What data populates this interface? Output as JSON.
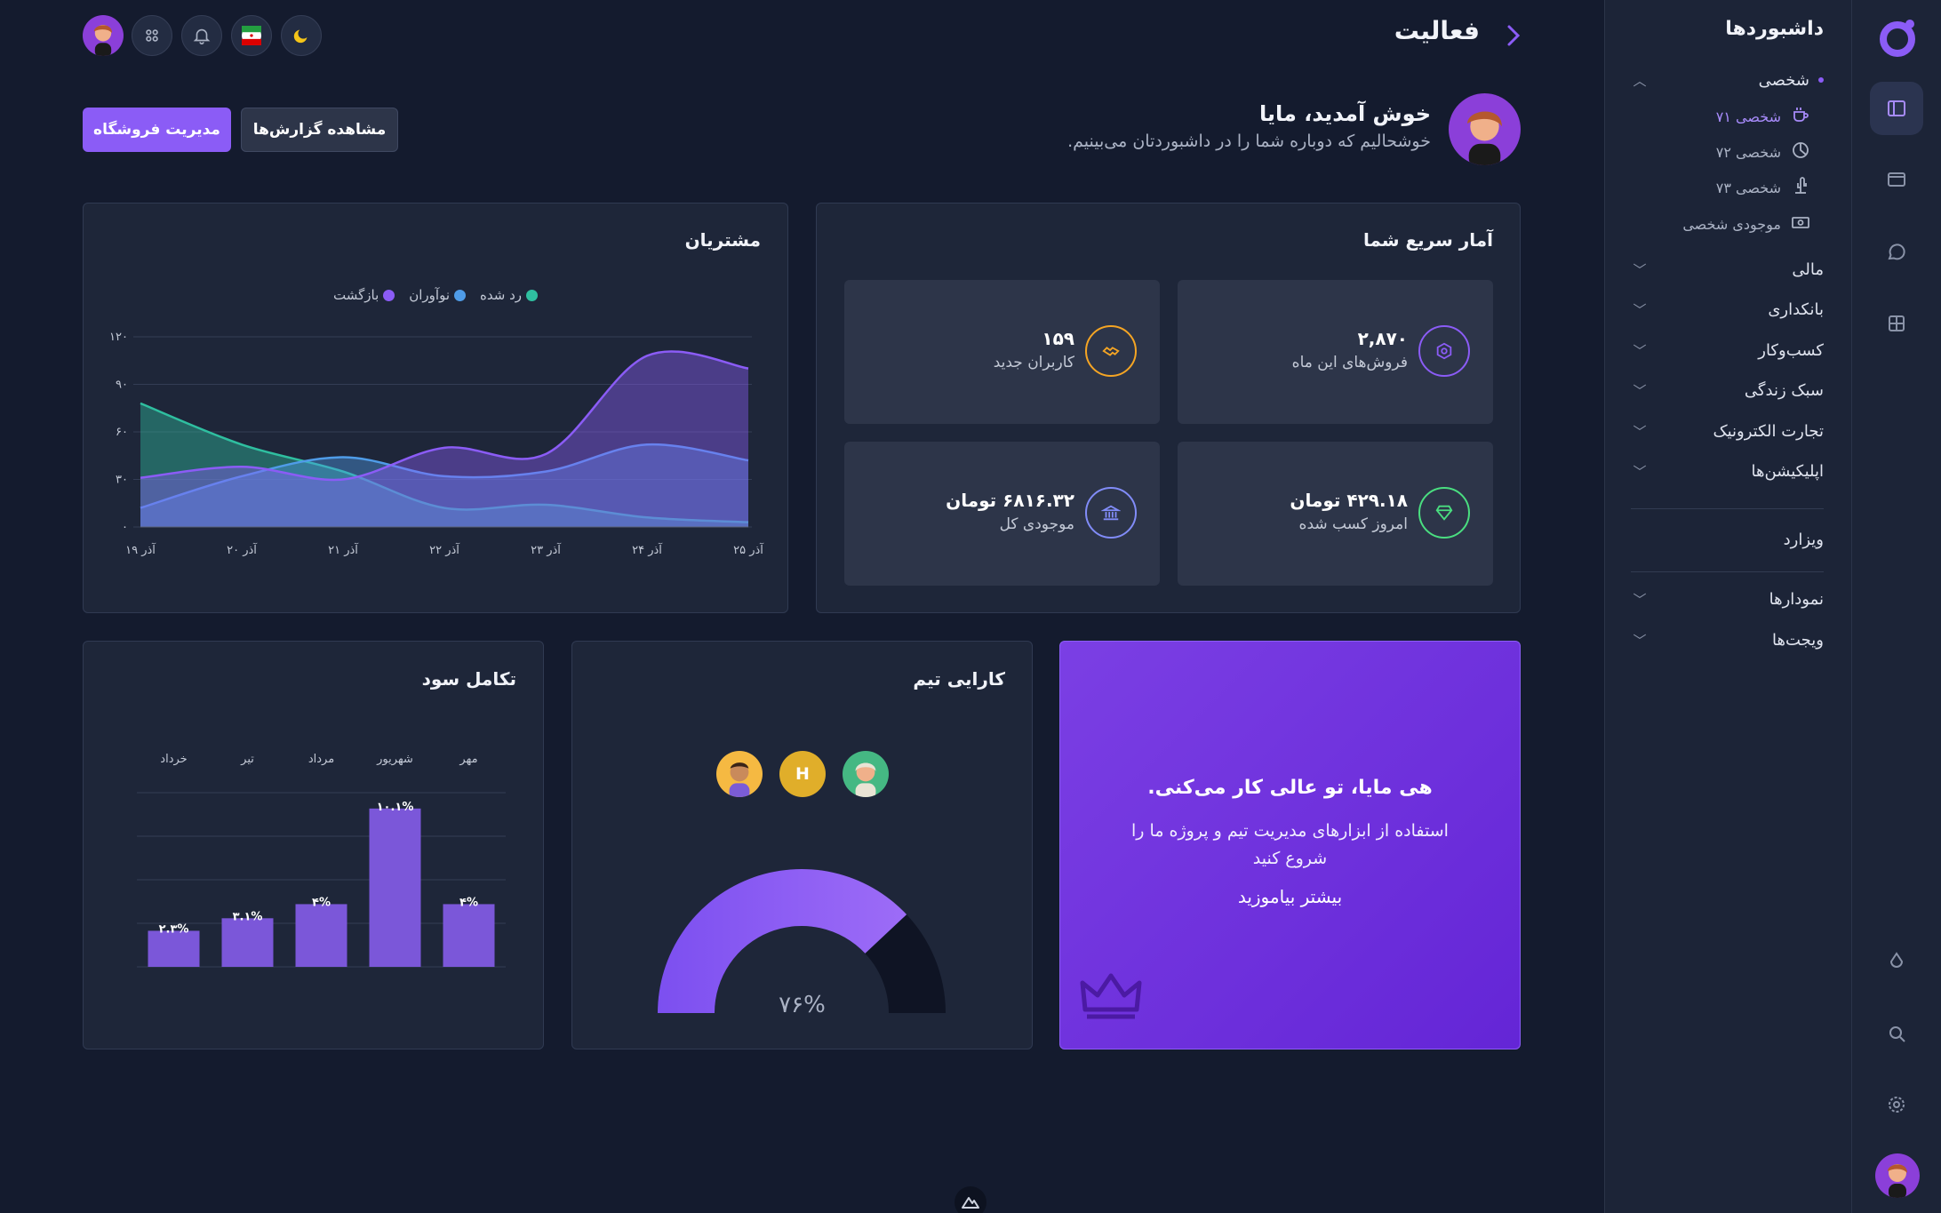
{
  "header": {
    "title": "فعالیت",
    "welcome_title": "خوش آمدید، مایا",
    "welcome_subtitle": "خوشحالیم که دوباره شما را در داشبوردتان می‌بینیم.",
    "btn_reports": "مشاهده گزارش‌ها",
    "btn_store": "مدیریت فروشگاه"
  },
  "sidebar": {
    "title": "داشبوردها",
    "section_personal": "شخصی",
    "sub_items": [
      {
        "label": "شخصی ۷۱",
        "icon": "coffee-icon"
      },
      {
        "label": "شخصی ۷۲",
        "icon": "pie-icon"
      },
      {
        "label": "شخصی ۷۳",
        "icon": "cactus-icon"
      },
      {
        "label": "موجودی شخصی",
        "icon": "money-icon"
      }
    ],
    "groups": [
      "مالی",
      "بانکداری",
      "کسب‌وکار",
      "سبک زندگی",
      "تجارت الکترونیک",
      "اپلیکیشن‌ها"
    ],
    "wizard": "ویزارد",
    "groups2": [
      "نمودارها",
      "ویجت‌ها"
    ]
  },
  "stats": {
    "title": "آمار سریع شما",
    "items": [
      {
        "value": "۲,۸۷۰",
        "label": "فروش‌های این ماه",
        "color": "#8b5cf6"
      },
      {
        "value": "۱۵۹",
        "label": "کاربران جدید",
        "color": "#f5a524"
      },
      {
        "value": "۴۲۹.۱۸ تومان",
        "label": "امروز کسب شده",
        "color": "#4ade80"
      },
      {
        "value": "۶۸۱۶.۳۲ تومان",
        "label": "موجودی کل",
        "color": "#818cf8"
      }
    ]
  },
  "customers": {
    "title": "مشتریان",
    "legend": [
      "رد شده",
      "نوآوران",
      "بازگشت"
    ]
  },
  "promo": {
    "title": "هی مایا، تو عالی کار می‌کنی.",
    "text": "استفاده از ابزارهای مدیریت تیم و پروژه ما را شروع کنید",
    "link": "بیشتر بیاموزید"
  },
  "team": {
    "title": "کارایی تیم",
    "avatar_letter": "H",
    "percent": "۷۶%",
    "value": 0.76
  },
  "profit": {
    "title": "تکامل سود"
  },
  "colors": {
    "accent": "#8b5cf6",
    "promo_bg": "#6d34e0",
    "series_rejected": "#2fbfa0",
    "series_innovators": "#4f9ce8",
    "series_returning": "#8b5cf6"
  },
  "chart_data": [
    {
      "type": "area",
      "title": "مشتریان",
      "x": [
        "آذر ۱۹",
        "آذر ۲۰",
        "آذر ۲۱",
        "آذر ۲۲",
        "آذر ۲۳",
        "آذر ۲۴",
        "آذر ۲۵"
      ],
      "y_ticks": [
        "۰",
        "۳۰",
        "۶۰",
        "۹۰",
        "۱۲۰"
      ],
      "ylim": [
        0,
        120
      ],
      "grid": true,
      "legend_position": "top",
      "series": [
        {
          "name": "رد شده",
          "values": [
            78,
            52,
            35,
            12,
            14,
            6,
            3
          ]
        },
        {
          "name": "نوآوران",
          "values": [
            12,
            32,
            44,
            32,
            35,
            52,
            42
          ]
        },
        {
          "name": "بازگشت",
          "values": [
            31,
            38,
            30,
            50,
            46,
            108,
            100
          ]
        }
      ]
    },
    {
      "type": "bar",
      "title": "تکامل سود",
      "categories": [
        "مهر",
        "شهریور",
        "مرداد",
        "تیر",
        "خرداد"
      ],
      "values": [
        4,
        10.1,
        4,
        3.1,
        2.3
      ],
      "value_labels": [
        "۴%",
        "۱۰.۱%",
        "۴%",
        "۳.۱%",
        "۲.۳%"
      ],
      "ylim": [
        0,
        12
      ]
    }
  ]
}
